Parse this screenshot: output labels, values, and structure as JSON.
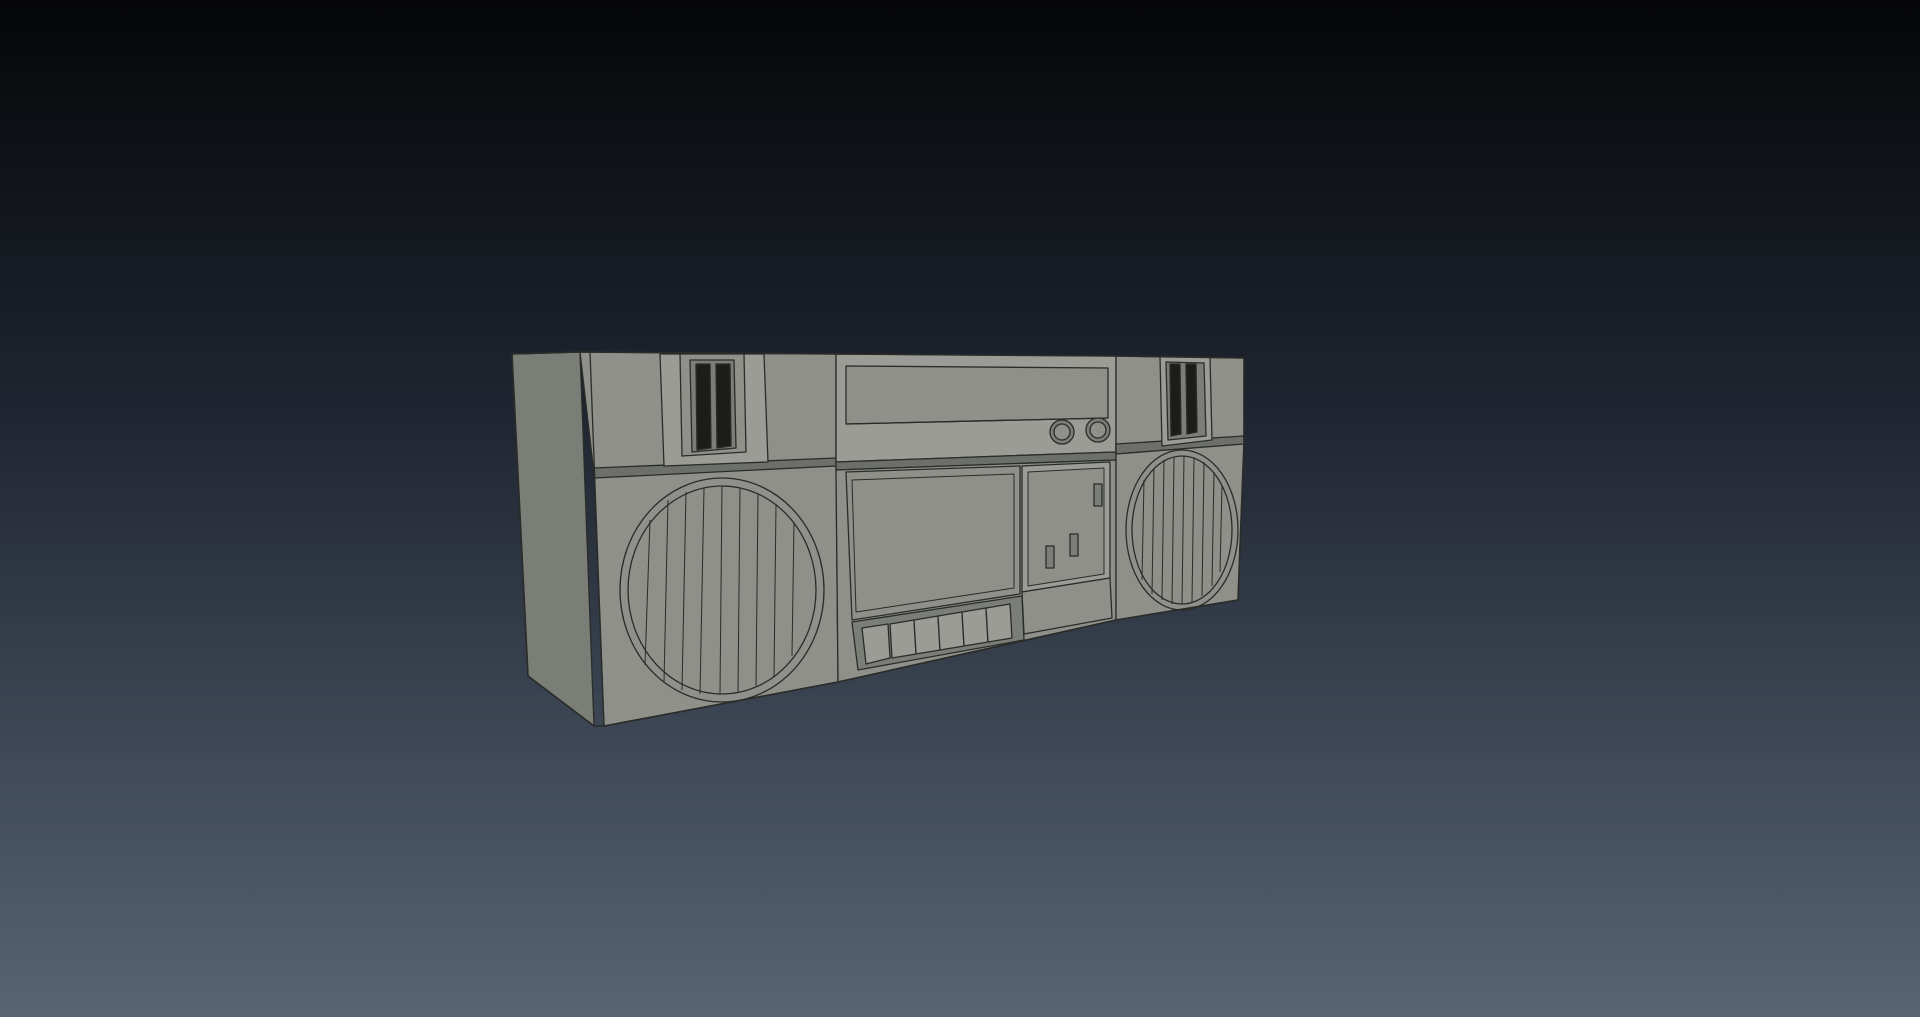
{
  "scene": {
    "subject": "boombox-3d-model",
    "render_style": "wireframe-on-shaded",
    "colors": {
      "background_top": "#050608",
      "background_mid": "#1f2530",
      "background_bottom": "#576474",
      "model_face": "#8e9089",
      "model_face_light": "#9a9c95",
      "model_side": "#7b7d77",
      "model_shadow": "#6d6f69",
      "wire": "#2a2c29",
      "slot_dark": "#1c1d1b"
    },
    "components": {
      "left_speaker": {
        "grille_slats": 9
      },
      "right_speaker": {
        "grille_slats": 9
      },
      "center_unit": {
        "knobs": 2,
        "switches": 3,
        "keys": 6
      }
    }
  }
}
